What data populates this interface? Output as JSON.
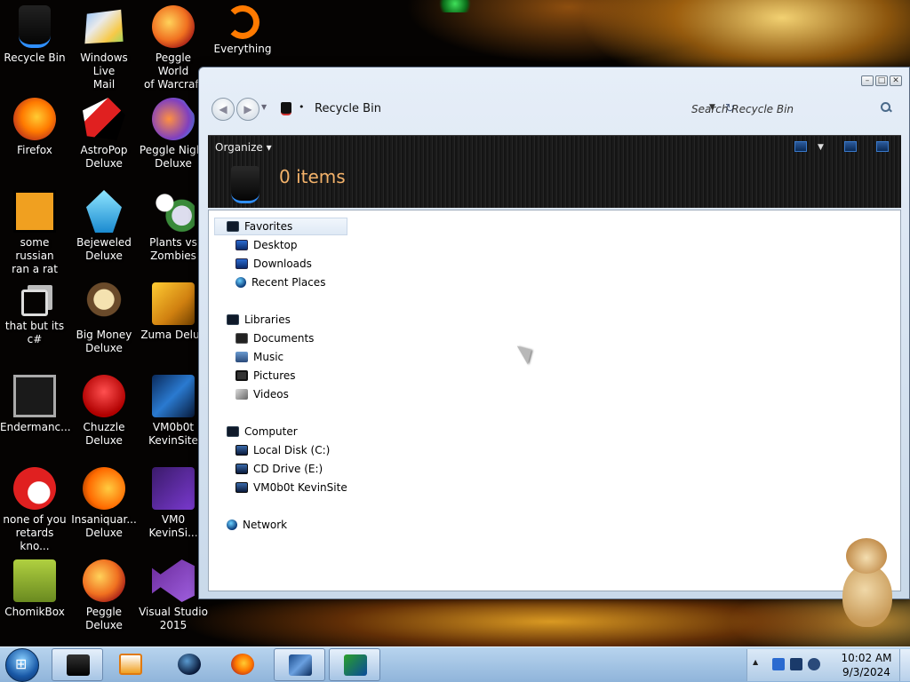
{
  "desktop": {
    "icons": [
      {
        "label": "Recycle Bin",
        "icon": "recycle-bin-icon"
      },
      {
        "label": "Windows Live\nMail",
        "icon": "mail-icon"
      },
      {
        "label": "Peggle World\nof Warcraft ...",
        "icon": "peggle-icon"
      },
      {
        "label": "Everything",
        "icon": "everything-icon"
      },
      {
        "label": "Firefox",
        "icon": "firefox-icon"
      },
      {
        "label": "AstroPop\nDeluxe",
        "icon": "astropop-icon"
      },
      {
        "label": "Peggle Night\nDeluxe",
        "icon": "peggle-night-icon"
      },
      {
        "label": "some russian\nran a rat",
        "icon": "app-icon"
      },
      {
        "label": "Bejeweled\nDeluxe",
        "icon": "bejeweled-icon"
      },
      {
        "label": "Plants vs\nZombies",
        "icon": "plants-icon"
      },
      {
        "label": "that but its c#",
        "icon": "files-icon"
      },
      {
        "label": "Big Money\nDeluxe",
        "icon": "money-icon"
      },
      {
        "label": "Zuma Delux",
        "icon": "zuma-icon"
      },
      {
        "label": "Endermanc...",
        "icon": "ender-icon"
      },
      {
        "label": "Chuzzle\nDeluxe",
        "icon": "chuzzle-icon"
      },
      {
        "label": "VM0b0t\nKevinSite",
        "icon": "vm-icon"
      },
      {
        "label": "none of you\nretards kno...",
        "icon": "app-icon"
      },
      {
        "label": "Insaniquar...\nDeluxe",
        "icon": "insaniquarium-icon"
      },
      {
        "label": "VM0\nKevinSi...",
        "icon": "vm-icon"
      },
      {
        "label": "ChomikBox",
        "icon": "chomikbox-icon"
      },
      {
        "label": "Peggle Deluxe",
        "icon": "peggle-icon"
      },
      {
        "label": "Visual Studio\n2015",
        "icon": "visual-studio-icon"
      }
    ]
  },
  "explorer": {
    "caption_buttons": {
      "minimize": "–",
      "maximize": "□",
      "close": "✕"
    },
    "address": {
      "location": "Recycle Bin",
      "separator": "•"
    },
    "search": {
      "placeholder": "Search Recycle Bin"
    },
    "toolbar": {
      "organize": "Organize ▾"
    },
    "header": {
      "item_count": "0 items"
    },
    "nav": {
      "favorites": "Favorites",
      "desktop": "Desktop",
      "downloads": "Downloads",
      "recent": "Recent Places",
      "libraries": "Libraries",
      "documents": "Documents",
      "music": "Music",
      "pictures": "Pictures",
      "videos": "Videos",
      "computer": "Computer",
      "local_disk": "Local Disk (C:)",
      "cd_drive": "CD Drive (E:)",
      "vm_drive": "VM0b0t KevinSite",
      "network": "Network"
    }
  },
  "taskbar": {
    "pinned": [
      {
        "name": "explorer",
        "icon": "folder-icon",
        "active": true
      },
      {
        "name": "media-player",
        "icon": "media-player-icon",
        "active": false
      },
      {
        "name": "browser",
        "icon": "globe-icon",
        "active": false
      },
      {
        "name": "firefox",
        "icon": "firefox-icon",
        "active": false
      },
      {
        "name": "virtualbox",
        "icon": "virtualbox-icon",
        "active": true
      },
      {
        "name": "download-manager",
        "icon": "download-manager-icon",
        "active": true
      }
    ],
    "clock": {
      "time": "10:02 AM",
      "date": "9/3/2024"
    }
  },
  "colors": {
    "header_text": "#f3b26a",
    "taskbar": "#a6c6e6",
    "accent": "#2f8fff"
  }
}
